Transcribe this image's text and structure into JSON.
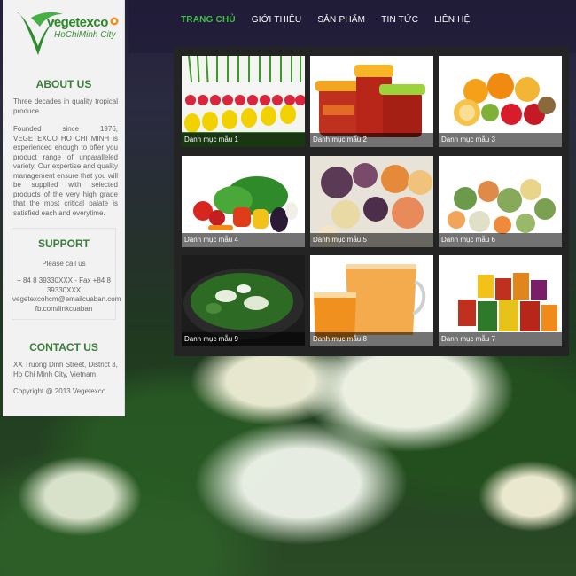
{
  "brand": {
    "name": "vegetexco",
    "sub": "HoChiMinh City"
  },
  "nav": {
    "items": [
      "TRANG CHỦ",
      "GIỚI THIỆU",
      "SẢN PHẨM",
      "TIN TỨC",
      "LIÊN HỆ"
    ]
  },
  "about": {
    "heading": "ABOUT US",
    "intro": "Three decades in quality tropical produce",
    "body": "Founded since 1976, VEGETEXCO HO CHI MINH is experienced enough to offer you product range of unparalleled variety. Our expertise and quality management ensure that you will be supplied with selected products of the very high grade that the most critical palate is satisfied each and everytime."
  },
  "support": {
    "heading": "SUPPORT",
    "call": "Please call us",
    "phone": "+ 84 8 39330XXX - Fax +84 8 39330XXX",
    "email": "vegetexcohcm@emailcuaban.com",
    "facebook": "fb.com/linkcuaban"
  },
  "contact": {
    "heading": "CONTACT US",
    "address": "XX Truong Dinh Street, District 3, Ho Chi Minh City, Vietnam",
    "copyright": "Copyright @ 2013 Vegetexco"
  },
  "gallery": {
    "tiles": [
      {
        "label": "Danh mục mẫu 1",
        "icon": "vegetables-photo"
      },
      {
        "label": "Danh mục mẫu 2",
        "icon": "jam-jars-photo"
      },
      {
        "label": "Danh mục mẫu 3",
        "icon": "fruit-photo"
      },
      {
        "label": "Danh mục mẫu 4",
        "icon": "vegetables-photo"
      },
      {
        "label": "Danh mục mẫu 5",
        "icon": "frozen-fruit-photo"
      },
      {
        "label": "Danh mục mẫu 6",
        "icon": "frozen-vegetables-photo"
      },
      {
        "label": "Danh mục mẫu 9",
        "icon": "spinach-pan-photo"
      },
      {
        "label": "Danh mục mẫu 8",
        "icon": "juice-glass-photo"
      },
      {
        "label": "Danh mục mẫu 7",
        "icon": "canned-food-photo"
      }
    ]
  },
  "colors": {
    "accent": "#3fbf3f",
    "heading": "#3b7d3b",
    "sidebar_bg": "#f2f2f2",
    "panel_bg": "#242424"
  }
}
